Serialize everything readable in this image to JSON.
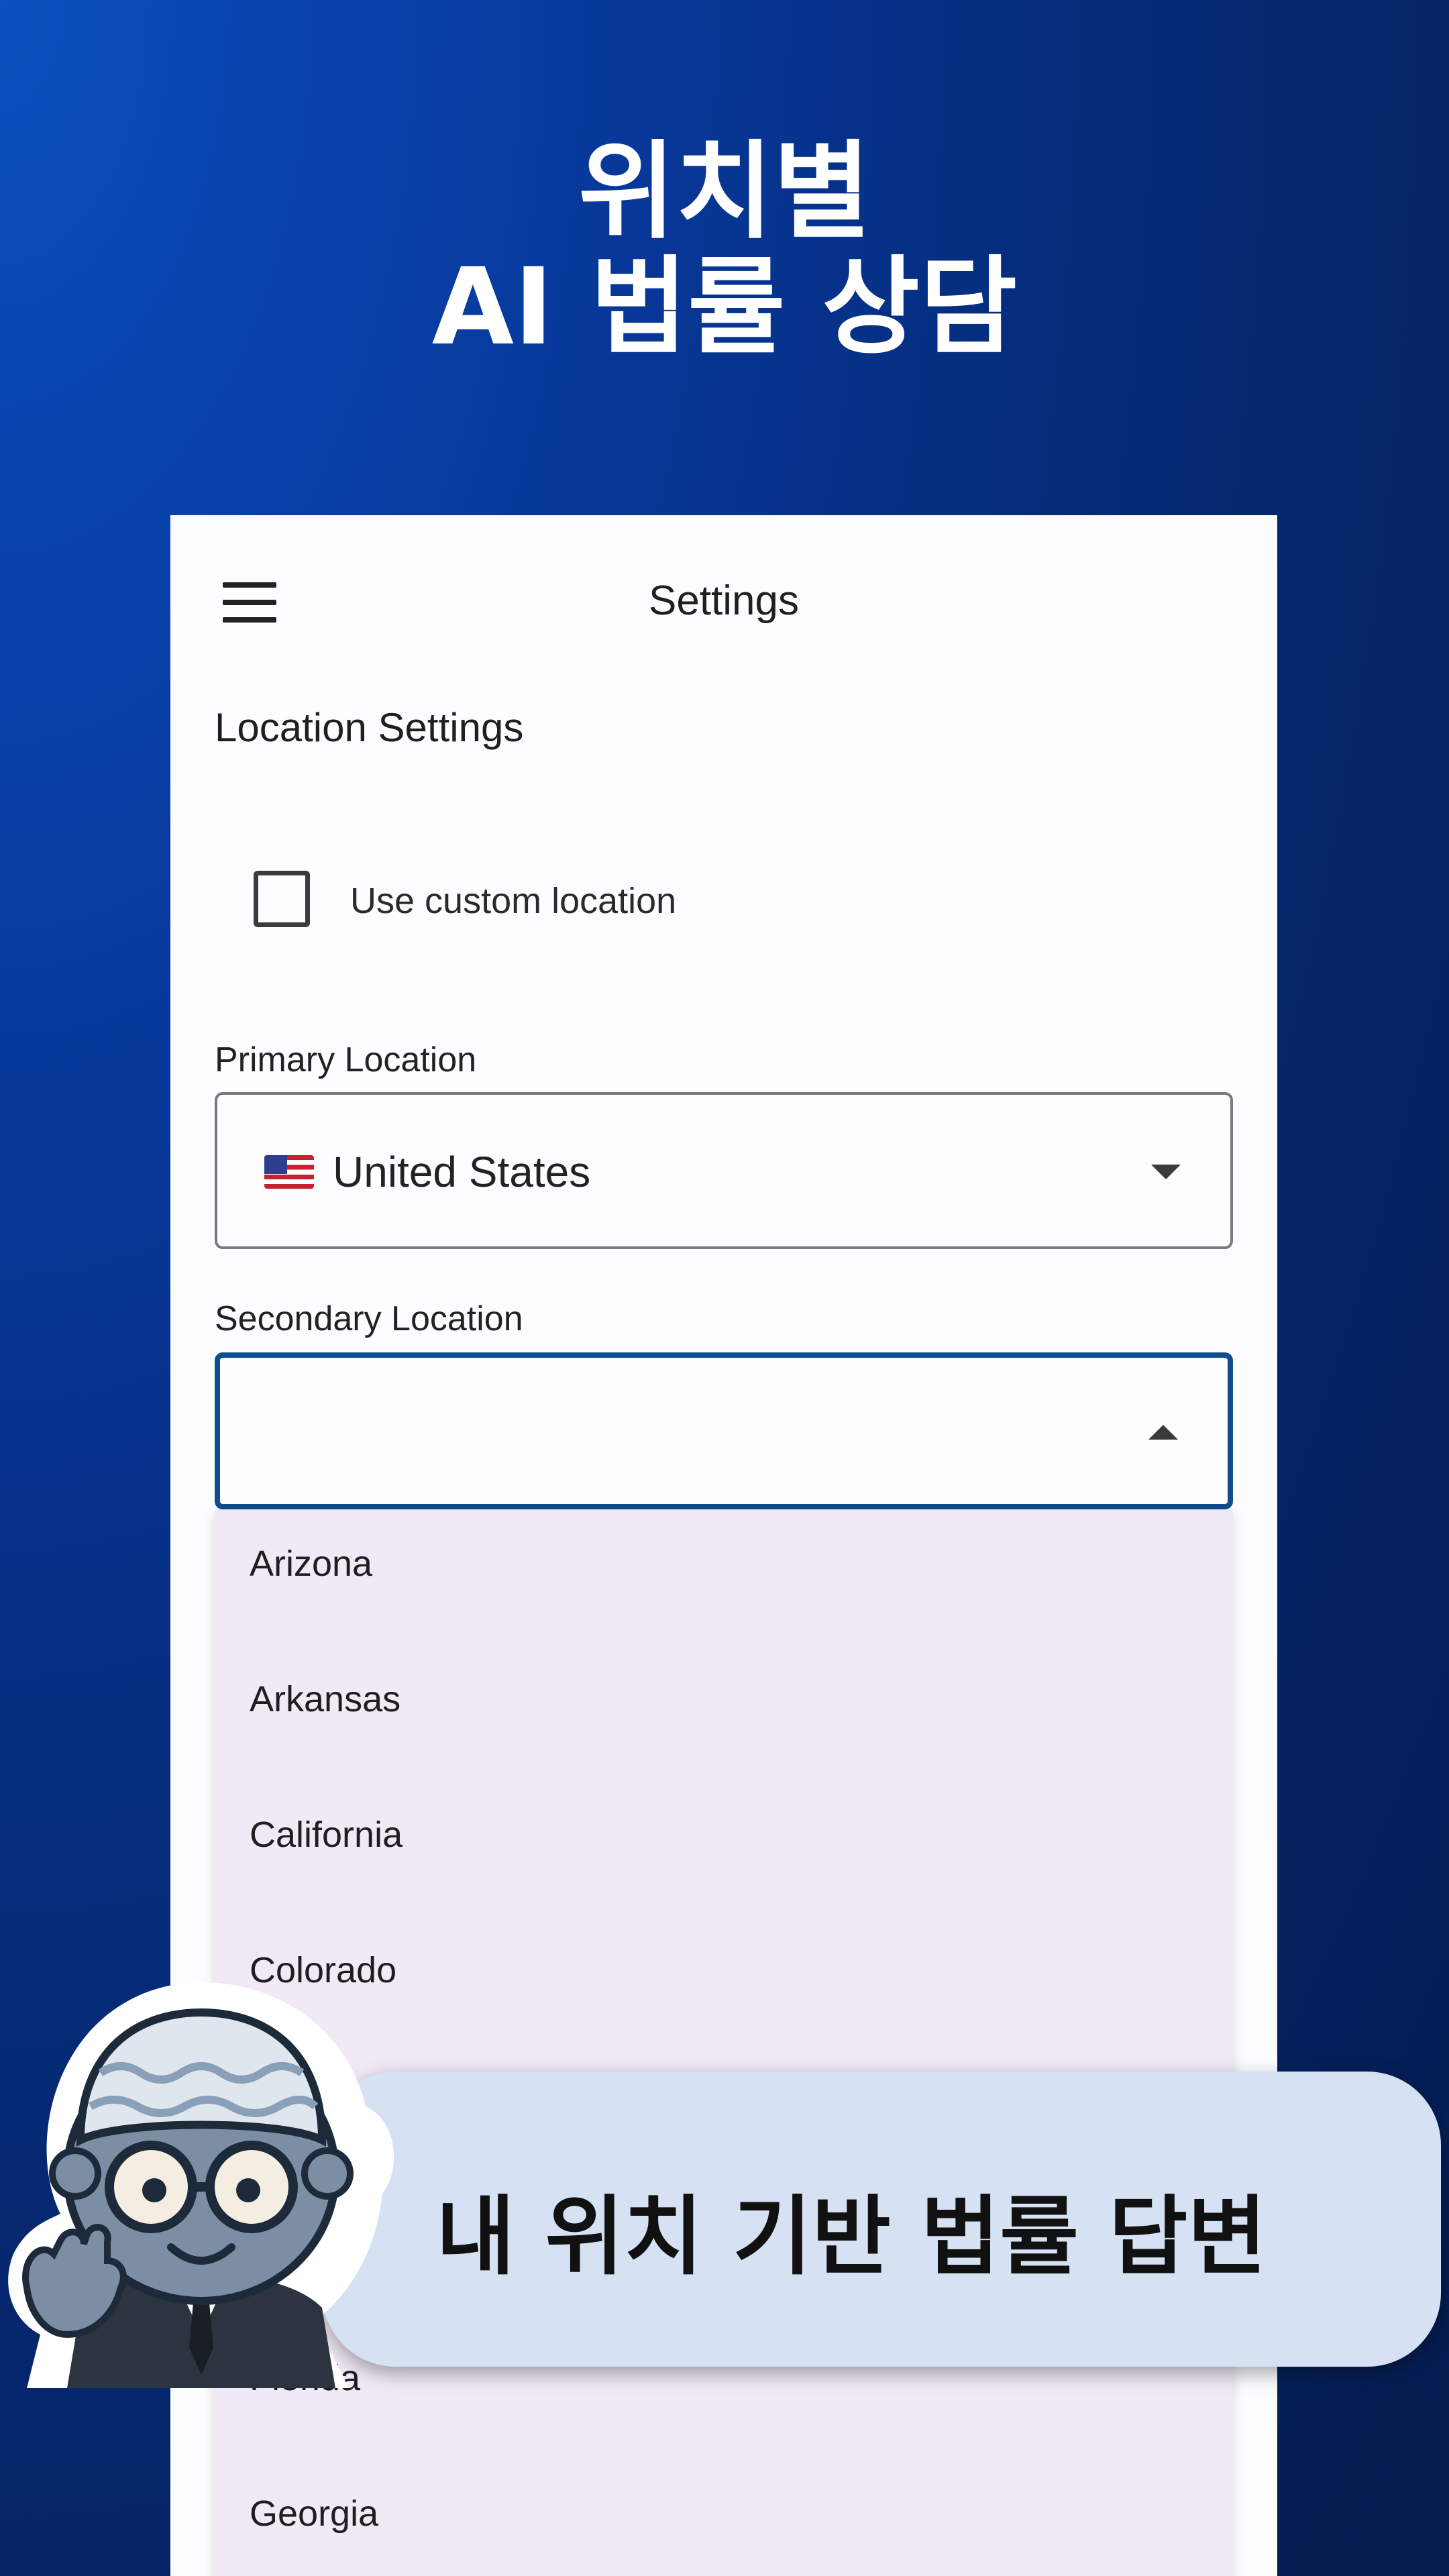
{
  "headline": {
    "line1": "위치별",
    "line2": "AI 법률 상담"
  },
  "appbar": {
    "title": "Settings",
    "menu_icon": "hamburger-menu-icon"
  },
  "location_settings": {
    "section_title": "Location Settings",
    "custom_location": {
      "label": "Use custom location",
      "checked": false
    },
    "primary": {
      "label": "Primary Location",
      "value": "United States",
      "flag_icon": "us-flag-icon"
    },
    "secondary": {
      "label": "Secondary Location",
      "value": ""
    }
  },
  "dropdown": {
    "options": [
      "Arizona",
      "Arkansas",
      "California",
      "Colorado",
      "Florida",
      "Georgia"
    ]
  },
  "banner": {
    "text": "내 위치 기반 법률 답변"
  },
  "colors": {
    "background": "#052870",
    "focus_border": "#0e4d8f",
    "dropdown_bg": "#f2e9f6",
    "banner_bg": "#d6e2f3"
  }
}
